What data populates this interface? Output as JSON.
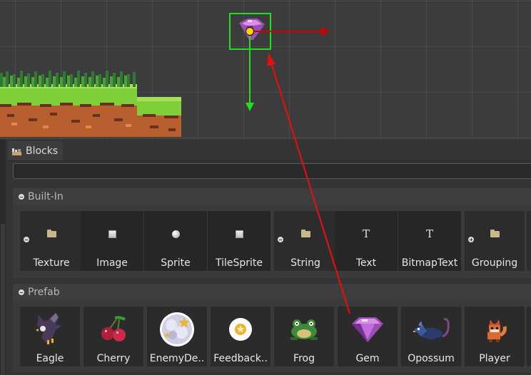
{
  "scene": {
    "selected_object": "gem-sprite",
    "colors": {
      "selection": "#1ee01e",
      "x_axis": "#d00000",
      "y_axis": "#1ee01e",
      "drag_arrow": "#e01010"
    }
  },
  "blocks_panel": {
    "tab_label": "Blocks",
    "search": {
      "value": "",
      "placeholder": ""
    },
    "builtin": {
      "header": "Built-In",
      "groups": [
        {
          "items": [
            {
              "label": "Texture",
              "icon": "folder-icon"
            },
            {
              "label": "Image",
              "icon": "image-square-icon"
            },
            {
              "label": "Sprite",
              "icon": "sprite-ball-icon"
            },
            {
              "label": "TileSprite",
              "icon": "tilesprite-square-icon"
            }
          ]
        },
        {
          "items": [
            {
              "label": "String",
              "icon": "folder-icon"
            },
            {
              "label": "Text",
              "icon": "text-t-icon"
            },
            {
              "label": "BitmapText",
              "icon": "bitmaptext-t-icon"
            }
          ]
        },
        {
          "items": [
            {
              "label": "Grouping",
              "icon": "folder-icon"
            }
          ]
        }
      ]
    },
    "prefab": {
      "header": "Prefab",
      "items": [
        {
          "label": "Eagle",
          "icon": "eagle-icon"
        },
        {
          "label": "Cherry",
          "icon": "cherry-icon"
        },
        {
          "label": "EnemyDe..",
          "icon": "enemy-death-icon"
        },
        {
          "label": "Feedback..",
          "icon": "feedback-icon"
        },
        {
          "label": "Frog",
          "icon": "frog-icon"
        },
        {
          "label": "Gem",
          "icon": "gem-icon"
        },
        {
          "label": "Opossum",
          "icon": "opossum-icon"
        },
        {
          "label": "Player",
          "icon": "player-icon"
        }
      ]
    }
  }
}
